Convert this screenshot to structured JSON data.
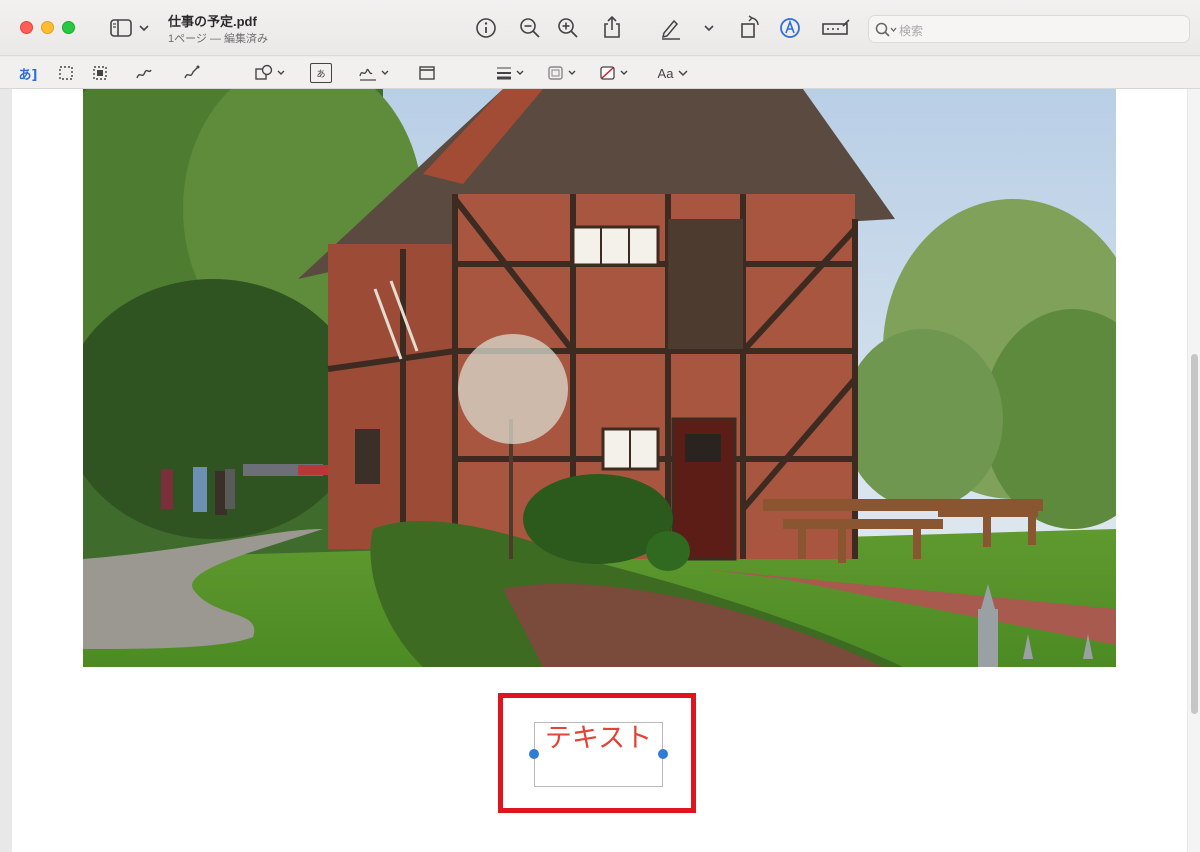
{
  "window": {
    "title": "仕事の予定.pdf",
    "subtitle": "1ページ — 編集済み"
  },
  "search": {
    "placeholder": "検索"
  },
  "toolbar": {
    "icons": [
      "sidebar-icon",
      "info-icon",
      "zoom-out-icon",
      "zoom-in-icon",
      "share-icon",
      "highlight-pen-icon",
      "rotate-icon",
      "markup-icon",
      "annotate-icon",
      "search-icon"
    ]
  },
  "markup_toolbar": {
    "text_select_glyph": "あ]",
    "text_box_glyph": "あ",
    "font_label": "Aa"
  },
  "annotation": {
    "text": "テキスト",
    "text_color": "#e34234",
    "highlight_color": "#e0141e",
    "handle_color": "#2f7bd6"
  }
}
